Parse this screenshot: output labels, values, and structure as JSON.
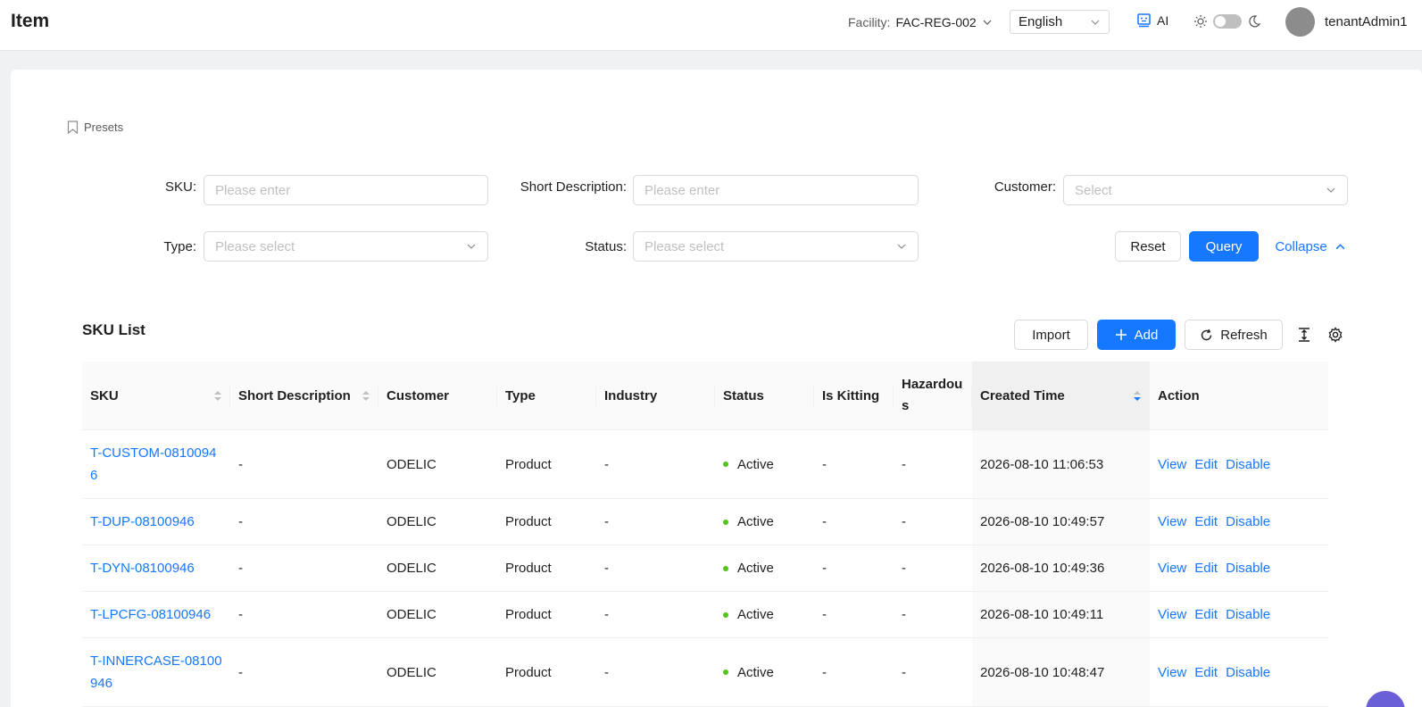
{
  "header": {
    "title": "Item",
    "facility_label": "Facility:",
    "facility_value": "FAC-REG-002",
    "language": "English",
    "ai_label": "AI",
    "username": "tenantAdmin1"
  },
  "filters": {
    "presets_label": "Presets",
    "sku": {
      "label": "SKU:",
      "placeholder": "Please enter"
    },
    "short_description": {
      "label": "Short Description:",
      "placeholder": "Please enter"
    },
    "customer": {
      "label": "Customer:",
      "placeholder": "Select"
    },
    "type": {
      "label": "Type:",
      "placeholder": "Please select"
    },
    "status": {
      "label": "Status:",
      "placeholder": "Please select"
    },
    "reset_label": "Reset",
    "query_label": "Query",
    "collapse_label": "Collapse"
  },
  "list": {
    "title": "SKU List",
    "import_label": "Import",
    "add_label": "Add",
    "refresh_label": "Refresh"
  },
  "table": {
    "columns": [
      "SKU",
      "Short Description",
      "Customer",
      "Type",
      "Industry",
      "Status",
      "Is Kitting",
      "Hazardous",
      "Created Time",
      "Action"
    ],
    "actions": {
      "view": "View",
      "edit": "Edit",
      "disable": "Disable"
    },
    "rows": [
      {
        "sku": "T-CUSTOM-08100946",
        "desc": "-",
        "customer": "ODELIC",
        "type": "Product",
        "industry": "-",
        "status": "Active",
        "kitting": "-",
        "hazardous": "-",
        "created": "2026-08-10 11:06:53"
      },
      {
        "sku": "T-DUP-08100946",
        "desc": "-",
        "customer": "ODELIC",
        "type": "Product",
        "industry": "-",
        "status": "Active",
        "kitting": "-",
        "hazardous": "-",
        "created": "2026-08-10 10:49:57"
      },
      {
        "sku": "T-DYN-08100946",
        "desc": "-",
        "customer": "ODELIC",
        "type": "Product",
        "industry": "-",
        "status": "Active",
        "kitting": "-",
        "hazardous": "-",
        "created": "2026-08-10 10:49:36"
      },
      {
        "sku": "T-LPCFG-08100946",
        "desc": "-",
        "customer": "ODELIC",
        "type": "Product",
        "industry": "-",
        "status": "Active",
        "kitting": "-",
        "hazardous": "-",
        "created": "2026-08-10 10:49:11"
      },
      {
        "sku": "T-INNERCASE-08100946",
        "desc": "-",
        "customer": "ODELIC",
        "type": "Product",
        "industry": "-",
        "status": "Active",
        "kitting": "-",
        "hazardous": "-",
        "created": "2026-08-10 10:48:47"
      }
    ]
  },
  "colors": {
    "primary": "#1677ff",
    "active_dot": "#52c41a"
  }
}
